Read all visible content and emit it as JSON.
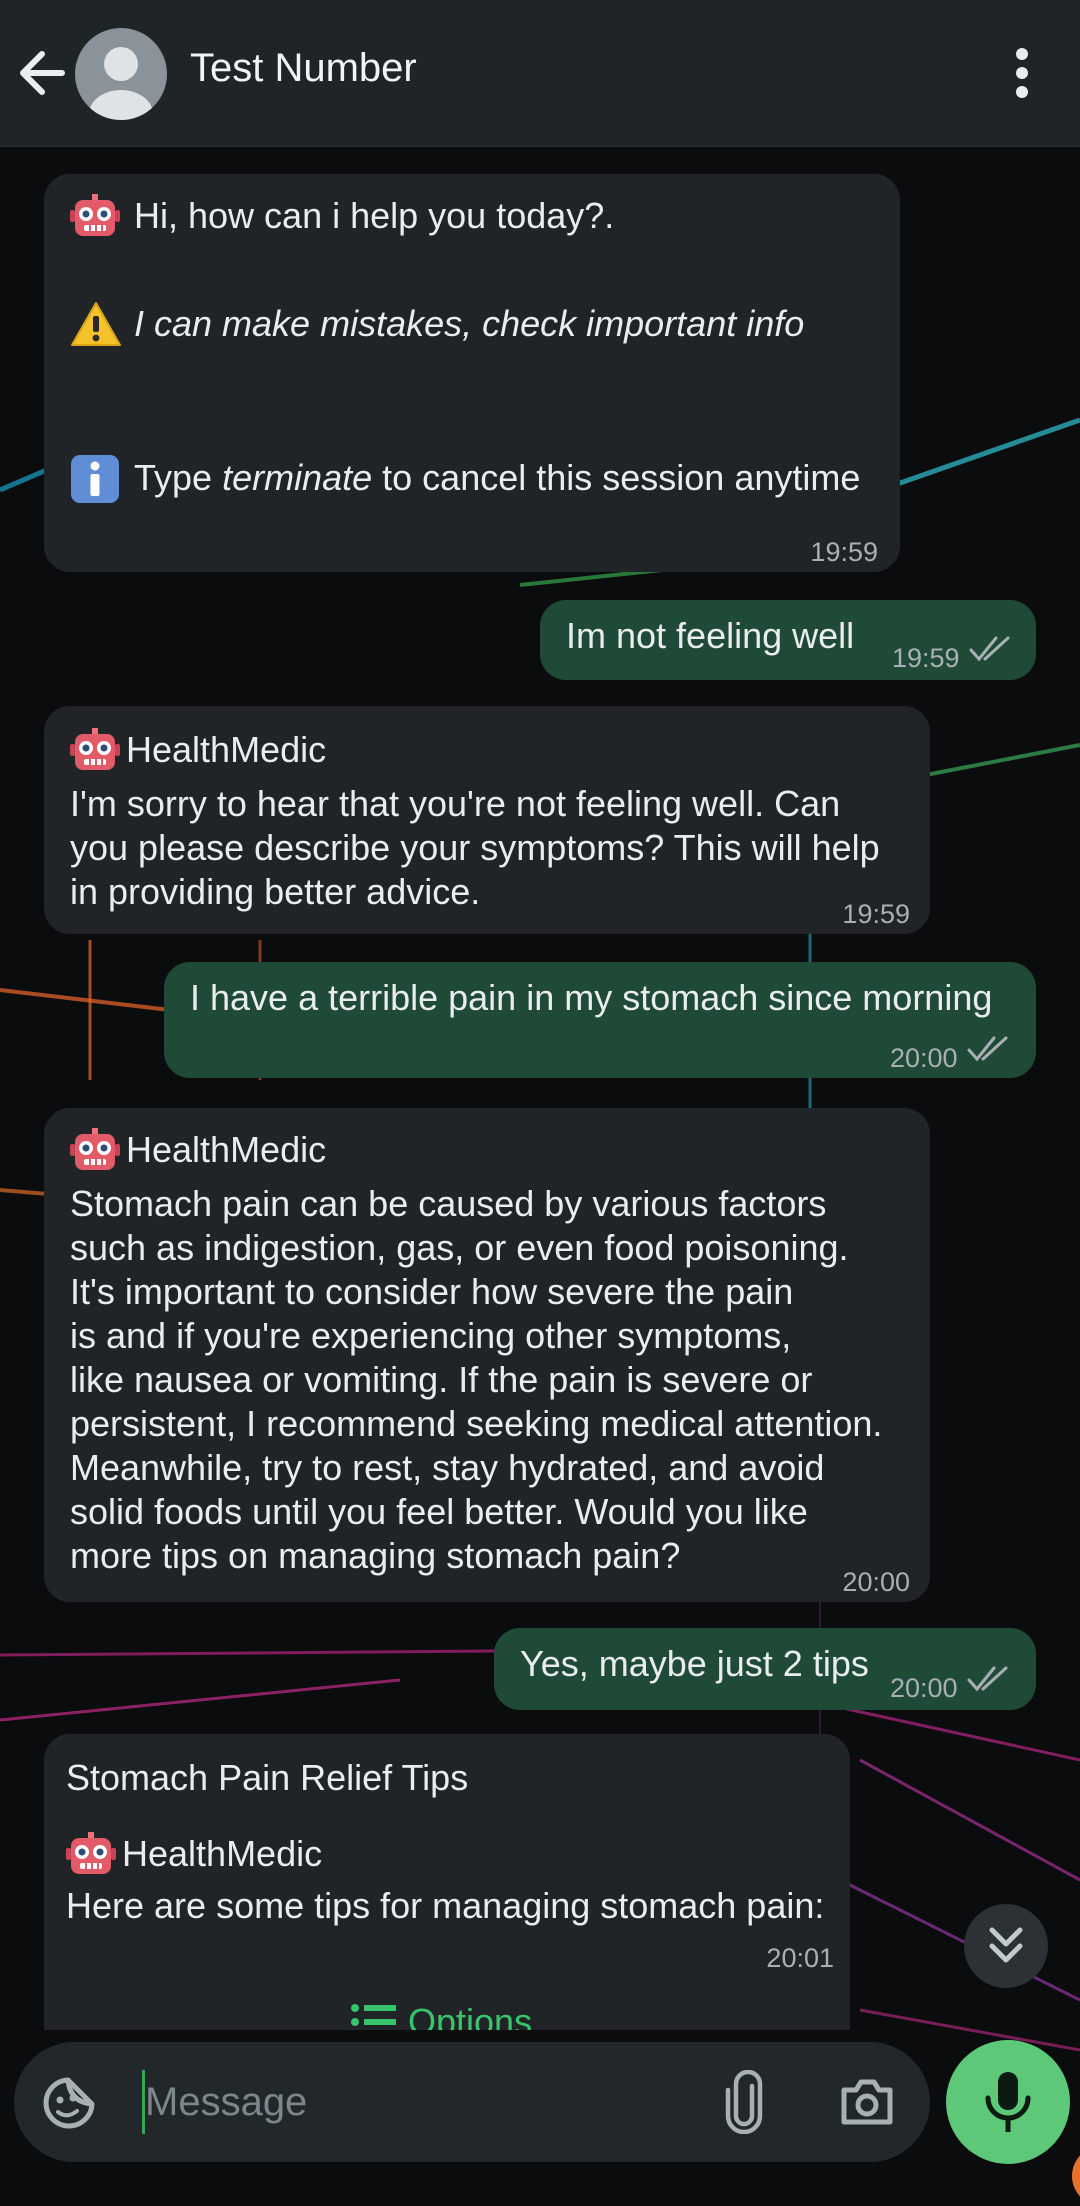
{
  "header": {
    "contact_name": "Test Number"
  },
  "messages": {
    "m1": {
      "greeting": "Hi, how can i help you today?.",
      "warning": "I can make mistakes, check important info",
      "info_prefix": "Type ",
      "info_em": "terminate",
      "info_suffix": " to cancel this session anytime",
      "time": "19:59"
    },
    "m2": {
      "text": "Im not feeling well",
      "time": "19:59"
    },
    "m3": {
      "sender": "HealthMedic",
      "text": "I'm sorry to hear that you're not feeling well. Can\nyou please describe your symptoms? This will help\nin providing better advice.",
      "time": "19:59"
    },
    "m4": {
      "text": "I have a terrible pain in my stomach since morning",
      "time": "20:00"
    },
    "m5": {
      "sender": "HealthMedic",
      "text": "Stomach pain can be caused by various factors\nsuch as indigestion, gas, or even food poisoning.\nIt's important to consider how severe the pain\nis and if you're experiencing other symptoms,\nlike nausea or vomiting. If the pain is severe or\npersistent, I recommend seeking medical attention.\nMeanwhile, try to rest, stay hydrated, and avoid\nsolid foods until you feel better. Would you like\nmore tips on managing stomach pain?",
      "time": "20:00"
    },
    "m6": {
      "text": "Yes, maybe just 2 tips",
      "time": "20:00"
    },
    "m7": {
      "title": "Stomach Pain Relief Tips",
      "sender": "HealthMedic",
      "text": "Here are some tips for managing stomach pain:",
      "time": "20:01",
      "options_label": "Options"
    }
  },
  "composer": {
    "placeholder": "Message"
  },
  "colors": {
    "incoming_bubble": "#202427",
    "outgoing_bubble": "#1f4a37",
    "accent_green": "#5dc878",
    "read_ticks": "#a8b0b4"
  },
  "icons": {
    "back": "arrow-left-icon",
    "menu": "more-vertical-icon",
    "robot": "robot-emoji-icon",
    "warning": "warning-emoji-icon",
    "info": "info-emoji-icon",
    "emoji": "sticker-icon",
    "attach": "paperclip-icon",
    "camera": "camera-icon",
    "mic": "microphone-icon",
    "scroll": "double-chevron-down-icon"
  }
}
